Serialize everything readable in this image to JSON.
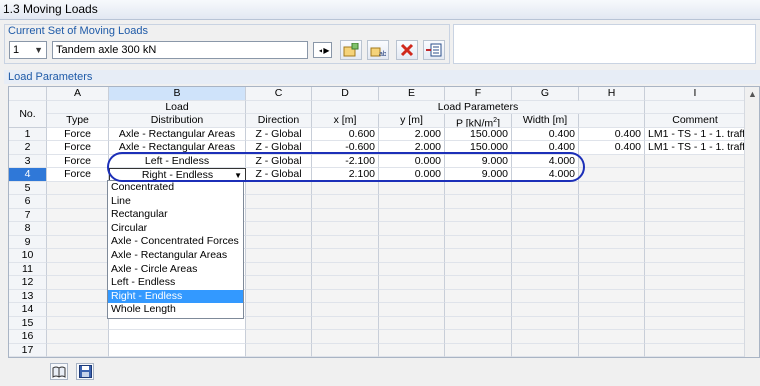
{
  "window": {
    "title": "1.3 Moving Loads"
  },
  "current_set": {
    "heading": "Current Set of Moving Loads",
    "number": "1",
    "name": "Tandem axle 300 kN"
  },
  "load_params": {
    "heading": "Load Parameters"
  },
  "columns": {
    "letters": [
      "A",
      "B",
      "C",
      "D",
      "E",
      "F",
      "G",
      "H",
      "I"
    ],
    "no_label": "No.",
    "group_load": "Load",
    "group_params": "Load Parameters",
    "sub": [
      "Type",
      "Distribution",
      "Direction",
      "x [m]",
      "y [m]",
      "P [kN/m2]",
      "Width [m]",
      "",
      "Comment"
    ]
  },
  "rows": [
    {
      "no": "1",
      "type": "Force",
      "dist": "Axle - Rectangular Areas",
      "dir": "Z - Global",
      "x": "0.600",
      "y": "2.000",
      "p": "150.000",
      "w": "0.400",
      "h": "0.400",
      "comment": "LM1 - TS - 1 - 1. traffic"
    },
    {
      "no": "2",
      "type": "Force",
      "dist": "Axle - Rectangular Areas",
      "dir": "Z - Global",
      "x": "-0.600",
      "y": "2.000",
      "p": "150.000",
      "w": "0.400",
      "h": "0.400",
      "comment": "LM1 - TS - 1 - 1. traffic"
    },
    {
      "no": "3",
      "type": "Force",
      "dist": "Left - Endless",
      "dir": "Z - Global",
      "x": "-2.100",
      "y": "0.000",
      "p": "9.000",
      "w": "4.000",
      "h": "",
      "comment": ""
    },
    {
      "no": "4",
      "type": "Force",
      "dist": "Right - Endless",
      "dir": "Z - Global",
      "x": "2.100",
      "y": "0.000",
      "p": "9.000",
      "w": "4.000",
      "h": "",
      "comment": ""
    },
    {
      "no": "5"
    },
    {
      "no": "6"
    },
    {
      "no": "7"
    },
    {
      "no": "8"
    },
    {
      "no": "9"
    },
    {
      "no": "10"
    },
    {
      "no": "11"
    },
    {
      "no": "12"
    },
    {
      "no": "13"
    },
    {
      "no": "14"
    },
    {
      "no": "15"
    },
    {
      "no": "16"
    },
    {
      "no": "17"
    }
  ],
  "dropdown": {
    "options": [
      "Concentrated",
      "Line",
      "Rectangular",
      "Circular",
      "Axle - Concentrated Forces",
      "Axle - Rectangular Areas",
      "Axle - Circle Areas",
      "Left - Endless",
      "Right - Endless",
      "Whole Length"
    ],
    "selected": "Right - Endless"
  },
  "colors": {
    "accent": "#1e5aa8",
    "selection": "#3399ff",
    "highlight_oval": "#1c2fb8"
  },
  "icons": [
    "chevron-down-icon",
    "nav-prev-icon",
    "nav-next-icon",
    "new-set-icon",
    "rename-icon",
    "delete-icon",
    "copy-icon",
    "book-icon",
    "save-icon",
    "scroll-up-icon"
  ]
}
